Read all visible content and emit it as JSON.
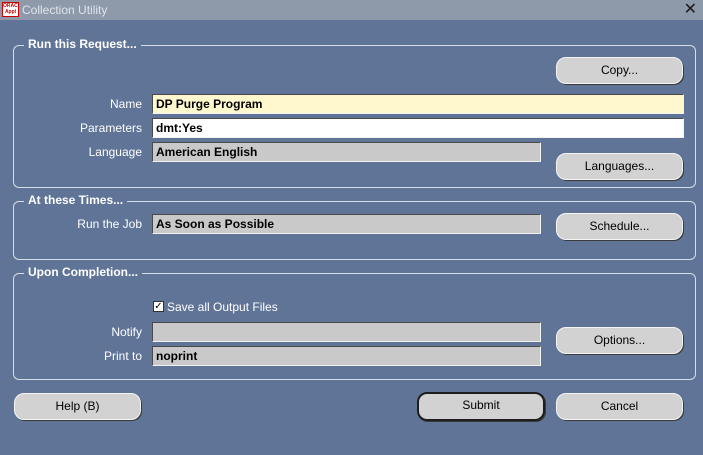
{
  "window": {
    "title": "Collection Utility",
    "logo_text": "ORACLE Applications"
  },
  "request": {
    "title": "Run this Request...",
    "copy_label": "Copy...",
    "name_label": "Name",
    "name_value": "DP Purge Program",
    "parameters_label": "Parameters",
    "parameters_value": "dmt:Yes",
    "language_label": "Language",
    "language_value": "American English",
    "languages_label": "Languages..."
  },
  "times": {
    "title": "At these Times...",
    "run_label": "Run the Job",
    "run_value": "As Soon as Possible",
    "schedule_label": "Schedule..."
  },
  "completion": {
    "title": "Upon Completion...",
    "save_output_label": "Save all Output Files",
    "save_output_checked": true,
    "notify_label": "Notify",
    "notify_value": "",
    "print_label": "Print to",
    "print_value": "noprint",
    "options_label": "Options..."
  },
  "footer": {
    "help_label": "Help (B)",
    "submit_label": "Submit",
    "cancel_label": "Cancel"
  },
  "colors": {
    "background": "#5f7497",
    "required_field": "#fff8cf",
    "readonly_field": "#c9c9c9",
    "button": "#d2d2d2"
  }
}
